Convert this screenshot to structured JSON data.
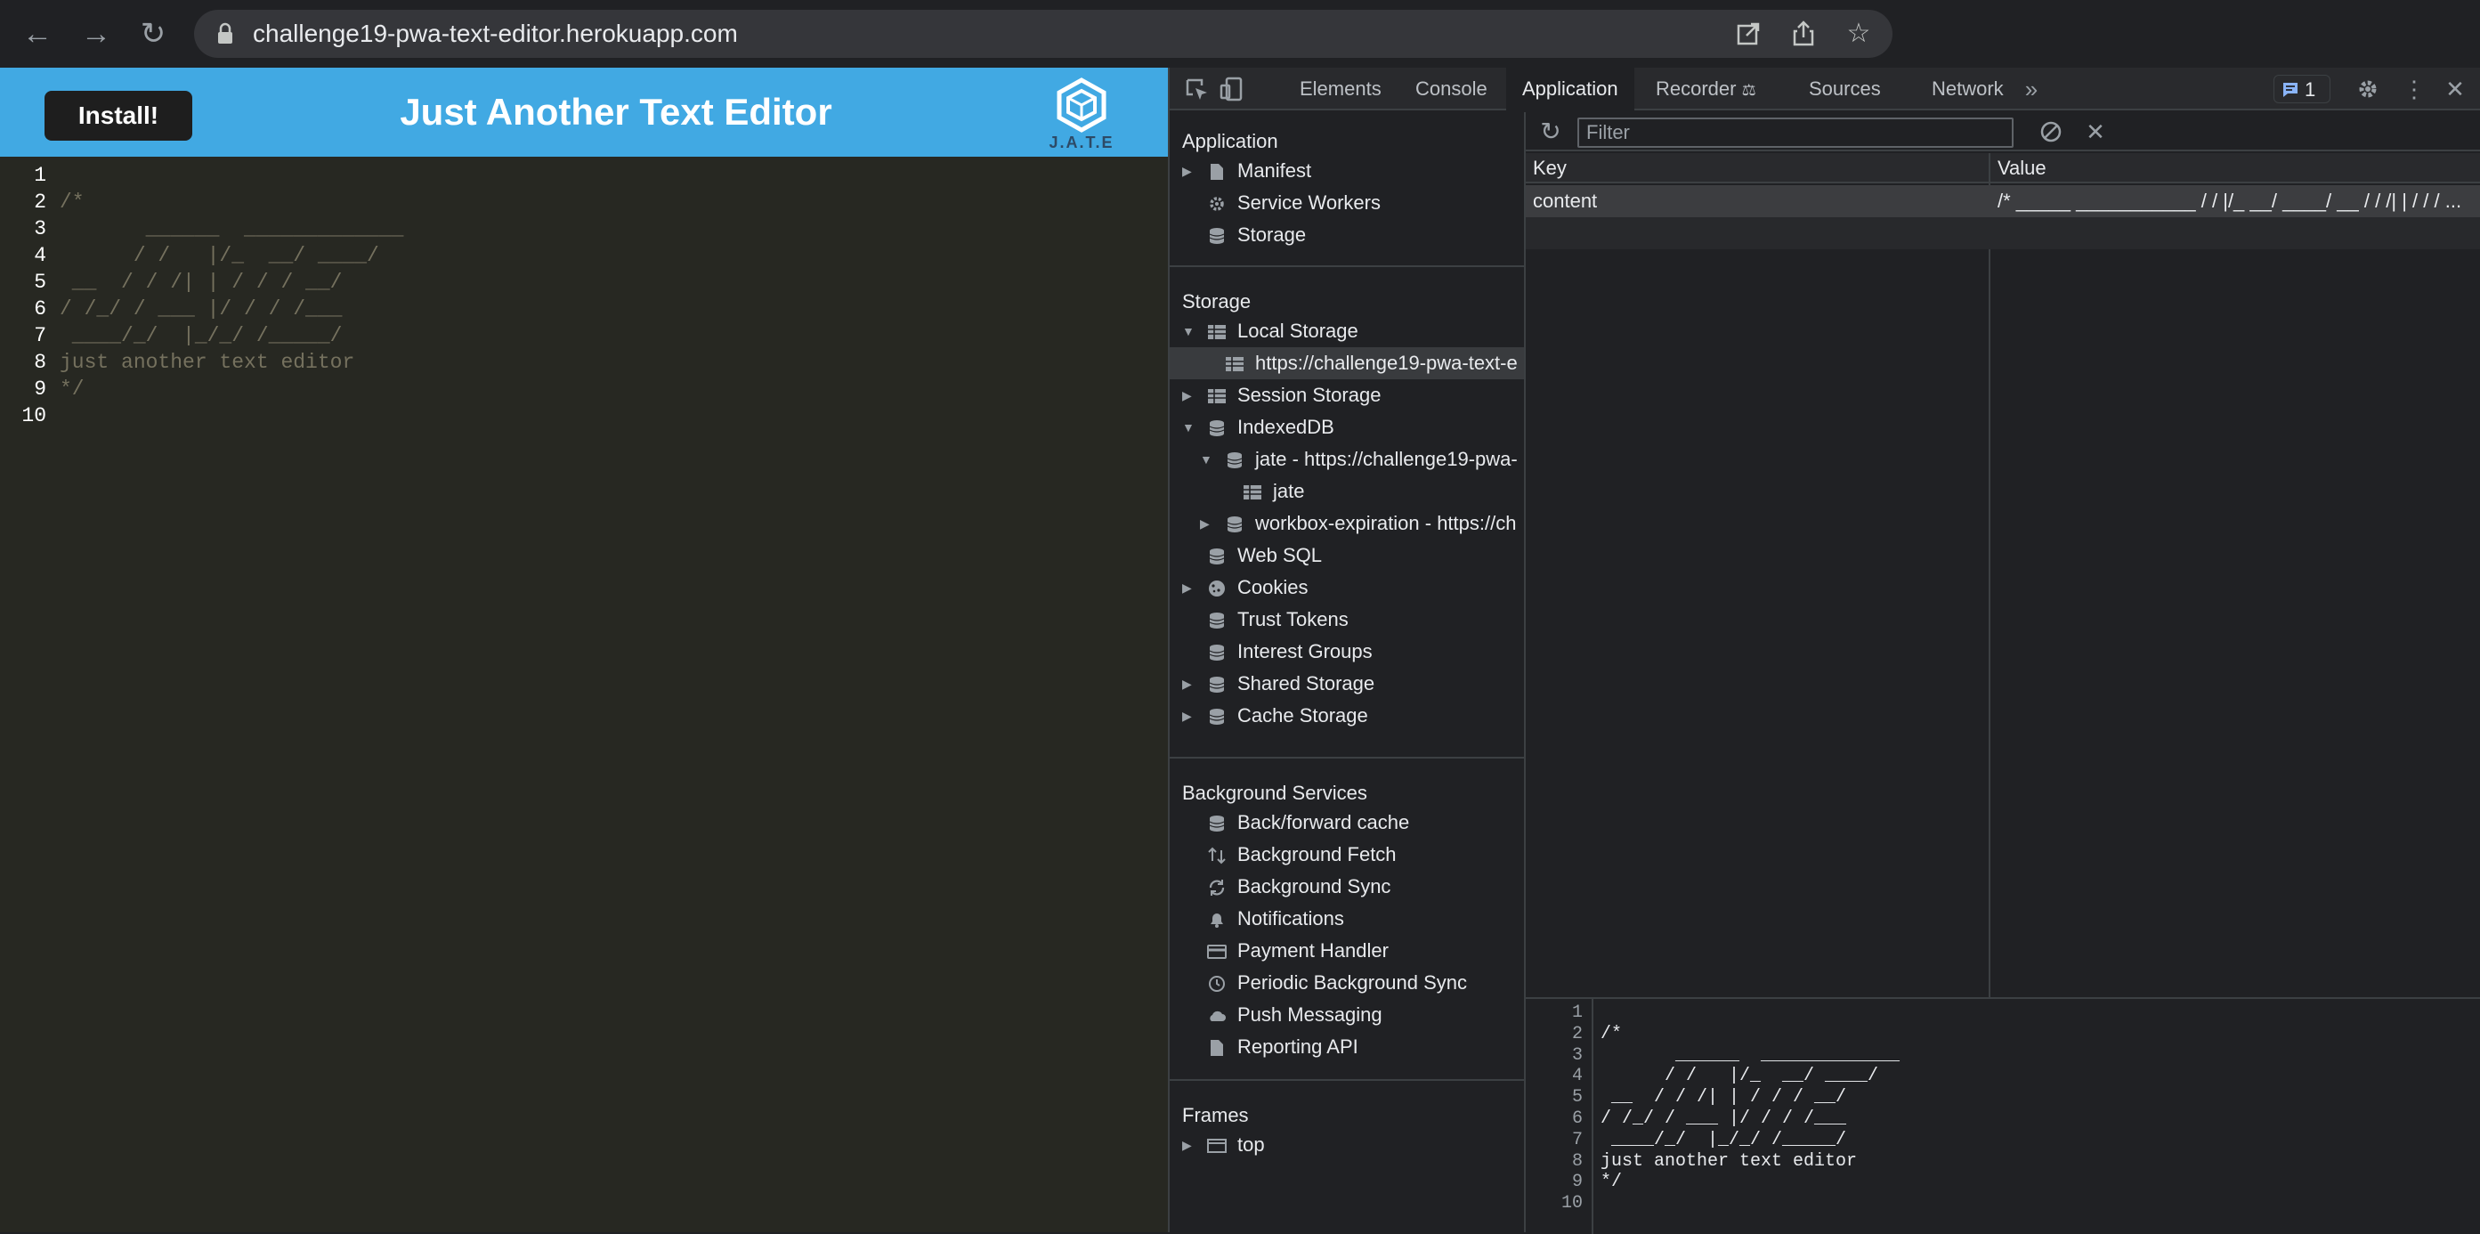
{
  "browser": {
    "url": "challenge19-pwa-text-editor.herokuapp.com"
  },
  "app": {
    "install_label": "Install!",
    "title": "Just Another Text Editor",
    "logo_text": "J.A.T.E",
    "header_color": "#41a9e3",
    "editor_bg": "#272822"
  },
  "editor": {
    "line_numbers": [
      "1",
      "2",
      "3",
      "4",
      "5",
      "6",
      "7",
      "8",
      "9",
      "10"
    ],
    "lines": [
      "",
      "/*",
      "       ______  _____________",
      "      / /   |/_  __/ ____/",
      " __  / / /| | / / / __/",
      "/ /_/ / ___ |/ / / /___",
      " ____/_/  |_/_/ /_____/",
      "just another text editor",
      "*/",
      ""
    ]
  },
  "devtools": {
    "tabs": [
      "Elements",
      "Console",
      "Application",
      "Recorder",
      "Sources",
      "Network"
    ],
    "active_tab": "Application",
    "issues_count": "1",
    "sidebar": {
      "application_title": "Application",
      "application_items": [
        "Manifest",
        "Service Workers",
        "Storage"
      ],
      "storage_title": "Storage",
      "storage_items": [
        "Local Storage",
        "https://challenge19-pwa-text-e",
        "Session Storage",
        "IndexedDB",
        "jate - https://challenge19-pwa-",
        "jate",
        "workbox-expiration - https://ch",
        "Web SQL",
        "Cookies",
        "Trust Tokens",
        "Interest Groups",
        "Shared Storage",
        "Cache Storage"
      ],
      "background_title": "Background Services",
      "background_items": [
        "Back/forward cache",
        "Background Fetch",
        "Background Sync",
        "Notifications",
        "Payment Handler",
        "Periodic Background Sync",
        "Push Messaging",
        "Reporting API"
      ],
      "frames_title": "Frames",
      "frames_items": [
        "top"
      ]
    },
    "filter_placeholder": "Filter",
    "table": {
      "headers": [
        "Key",
        "Value"
      ],
      "rows": [
        {
          "key": "content",
          "value": "/* _____ ___________ / / |/_ __/ ____/ __ / / /| | / / / ..."
        }
      ]
    },
    "preview": {
      "line_numbers": [
        "1",
        "2",
        "3",
        "4",
        "5",
        "6",
        "7",
        "8",
        "9",
        "10"
      ],
      "lines": [
        "",
        "/*",
        "       ______  _____________",
        "      / /   |/_  __/ ____/",
        " __  / / /| | / / / __/",
        "/ /_/ / ___ |/ / / /___",
        " ____/_/  |_/_/ /_____/",
        "just another text editor",
        "*/",
        ""
      ]
    }
  }
}
